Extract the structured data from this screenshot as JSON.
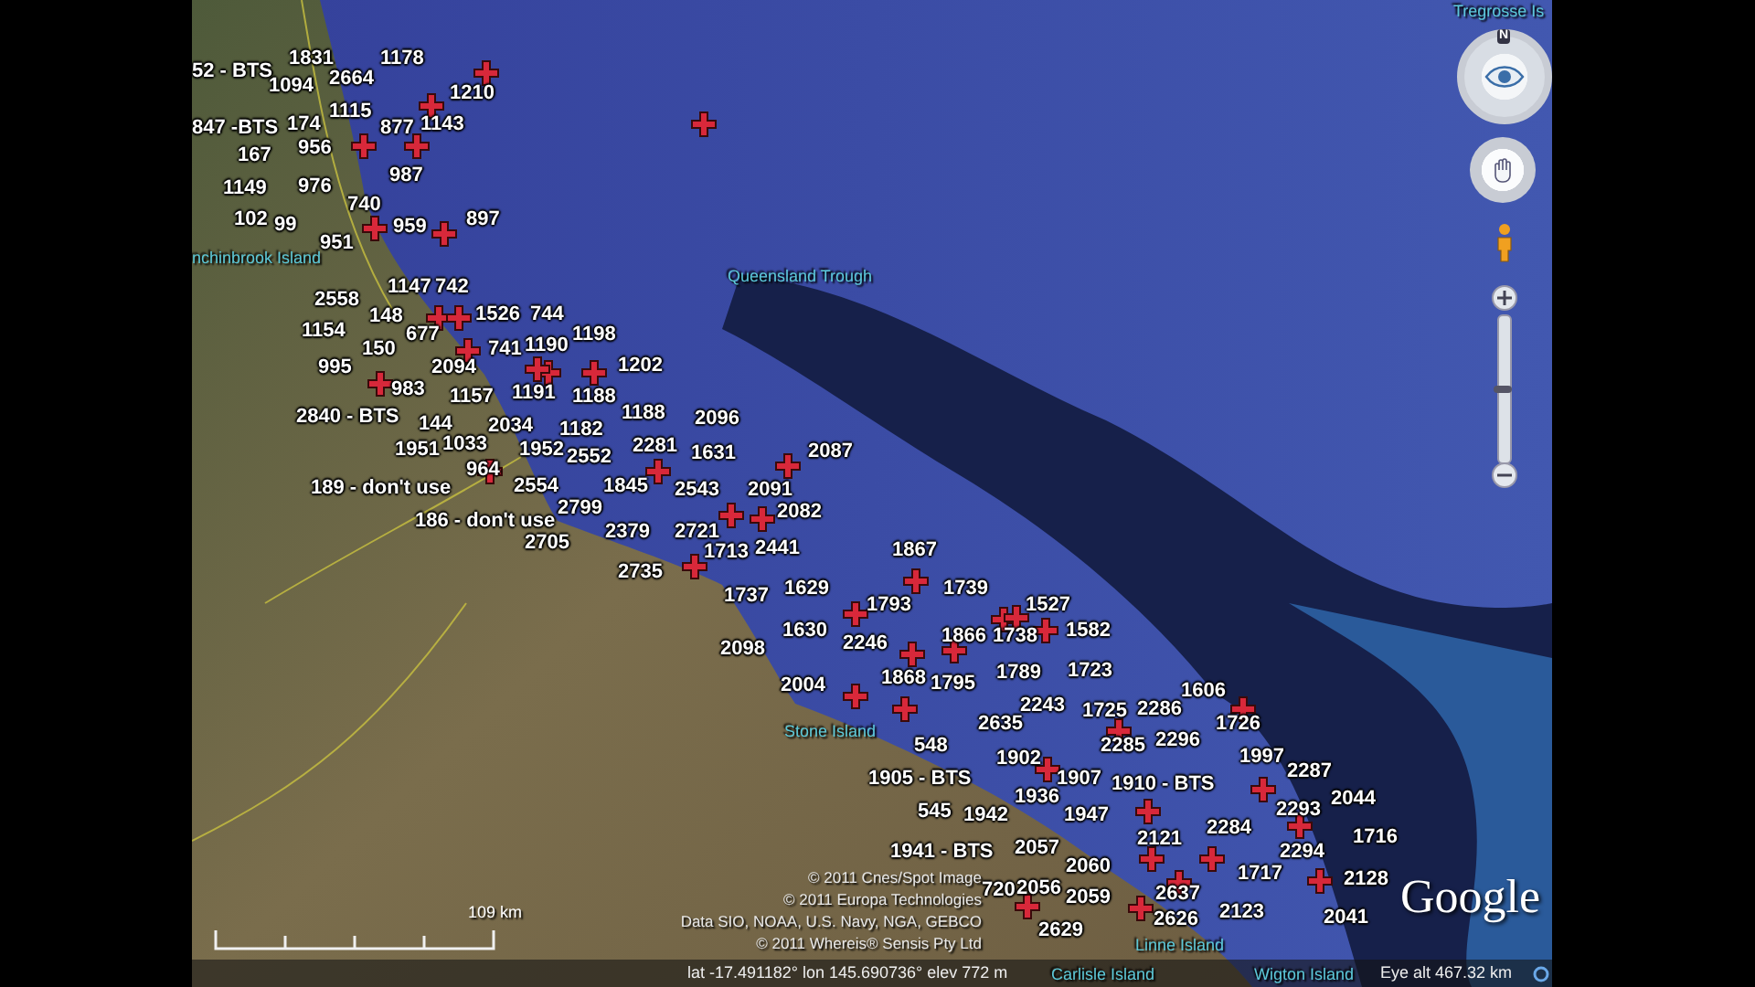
{
  "map": {
    "placemarks": [
      {
        "text": "52 - BTS"
      },
      {
        "text": "1831"
      },
      {
        "text": "1178"
      },
      {
        "text": "1094"
      },
      {
        "text": "2664"
      },
      {
        "text": "1210"
      },
      {
        "text": "1115"
      },
      {
        "text": "847 -BTS"
      },
      {
        "text": "174"
      },
      {
        "text": "877"
      },
      {
        "text": "1143"
      },
      {
        "text": "167"
      },
      {
        "text": "956"
      },
      {
        "text": "987"
      },
      {
        "text": "1149"
      },
      {
        "text": "976"
      },
      {
        "text": "740"
      },
      {
        "text": "102"
      },
      {
        "text": "99"
      },
      {
        "text": "959"
      },
      {
        "text": "897"
      },
      {
        "text": "951"
      },
      {
        "text": "1147"
      },
      {
        "text": "742"
      },
      {
        "text": "2558"
      },
      {
        "text": "148"
      },
      {
        "text": "1526"
      },
      {
        "text": "744"
      },
      {
        "text": "1154"
      },
      {
        "text": "677"
      },
      {
        "text": "1198"
      },
      {
        "text": "150"
      },
      {
        "text": "741"
      },
      {
        "text": "1190"
      },
      {
        "text": "995"
      },
      {
        "text": "2094"
      },
      {
        "text": "1202"
      },
      {
        "text": "983"
      },
      {
        "text": "1157"
      },
      {
        "text": "1191"
      },
      {
        "text": "1188"
      },
      {
        "text": "2840 - BTS"
      },
      {
        "text": "144"
      },
      {
        "text": "2034"
      },
      {
        "text": "1182"
      },
      {
        "text": "1188"
      },
      {
        "text": "2096"
      },
      {
        "text": "1951"
      },
      {
        "text": "1033"
      },
      {
        "text": "1952"
      },
      {
        "text": "2552"
      },
      {
        "text": "2281"
      },
      {
        "text": "1631"
      },
      {
        "text": "2087"
      },
      {
        "text": "964"
      },
      {
        "text": "189 - don't use"
      },
      {
        "text": "2554"
      },
      {
        "text": "1845"
      },
      {
        "text": "2543"
      },
      {
        "text": "2091"
      },
      {
        "text": "186 - don't use"
      },
      {
        "text": "2799"
      },
      {
        "text": "2082"
      },
      {
        "text": "2705"
      },
      {
        "text": "2379"
      },
      {
        "text": "2721"
      },
      {
        "text": "1713"
      },
      {
        "text": "2441"
      },
      {
        "text": "1867"
      },
      {
        "text": "2735"
      },
      {
        "text": "1737"
      },
      {
        "text": "1629"
      },
      {
        "text": "1793"
      },
      {
        "text": "1739"
      },
      {
        "text": "1527"
      },
      {
        "text": "2098"
      },
      {
        "text": "1630"
      },
      {
        "text": "2246"
      },
      {
        "text": "1866"
      },
      {
        "text": "1738"
      },
      {
        "text": "1582"
      },
      {
        "text": "2004"
      },
      {
        "text": "1868"
      },
      {
        "text": "1795"
      },
      {
        "text": "1789"
      },
      {
        "text": "1723"
      },
      {
        "text": "1606"
      },
      {
        "text": "2243"
      },
      {
        "text": "1725"
      },
      {
        "text": "2286"
      },
      {
        "text": "2635"
      },
      {
        "text": "1726"
      },
      {
        "text": "548"
      },
      {
        "text": "2285"
      },
      {
        "text": "2296"
      },
      {
        "text": "1902"
      },
      {
        "text": "1997"
      },
      {
        "text": "1905 - BTS"
      },
      {
        "text": "1907"
      },
      {
        "text": "1910 - BTS"
      },
      {
        "text": "2287"
      },
      {
        "text": "545"
      },
      {
        "text": "1942"
      },
      {
        "text": "1936"
      },
      {
        "text": "1947"
      },
      {
        "text": "2293"
      },
      {
        "text": "2044"
      },
      {
        "text": "1941 - BTS"
      },
      {
        "text": "2057"
      },
      {
        "text": "2121"
      },
      {
        "text": "2284"
      },
      {
        "text": "2294"
      },
      {
        "text": "1716"
      },
      {
        "text": "2060"
      },
      {
        "text": "1717"
      },
      {
        "text": "720"
      },
      {
        "text": "2056"
      },
      {
        "text": "2059"
      },
      {
        "text": "2637"
      },
      {
        "text": "2128"
      },
      {
        "text": "2629"
      },
      {
        "text": "2626"
      },
      {
        "text": "2123"
      },
      {
        "text": "2041"
      }
    ],
    "place_names": [
      "Tregrosse Is",
      "nchinbrook Island",
      "Queensland Trough",
      "Stone Island",
      "Linne Island",
      "Carlisle Island",
      "Wigton Island"
    ],
    "attribution": [
      "© 2011 Cnes/Spot Image",
      "© 2011 Europa Technologies",
      "Data SIO, NOAA, U.S. Navy, NGA, GEBCO",
      "© 2011 Whereis® Sensis Pty Ltd"
    ],
    "scale_label": "109 km",
    "logo": "Google"
  },
  "navigation": {
    "compass_letter": "N",
    "zoom_slider": {
      "level": 0.5
    }
  },
  "status_bar": {
    "coordinates": "lat -17.491182° lon 145.690736° elev 772 m",
    "eye_altitude": "Eye alt 467.32 km"
  }
}
